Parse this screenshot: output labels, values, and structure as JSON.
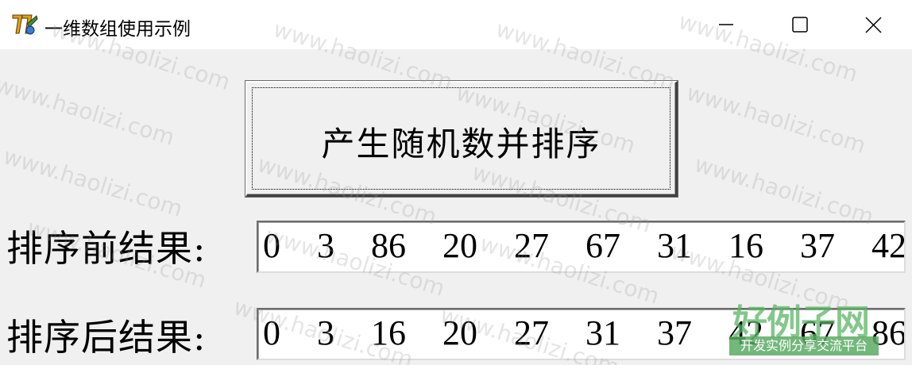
{
  "window": {
    "title": "一维数组使用示例",
    "icon": "vb-app-icon",
    "controls": {
      "minimize_icon": "minimize-icon",
      "maximize_icon": "maximize-icon",
      "close_icon": "close-icon"
    }
  },
  "main": {
    "generate_button_label": "产生随机数并排序",
    "before_label": "排序前结果:",
    "after_label": "排序后结果:",
    "before_value": "0  3  86  20  27  67  31  16  37  42",
    "after_value": "0  3  16  20  27  31  37  42  67  86"
  },
  "watermark": {
    "text": "www.haolizi.com",
    "logo_top": "好例子网",
    "logo_bottom": "开发实例分享交流平台"
  },
  "colors": {
    "window_bg": "#f0f0f0",
    "titlebar_bg": "#ffffff",
    "logo_green": "#5aaa64"
  }
}
